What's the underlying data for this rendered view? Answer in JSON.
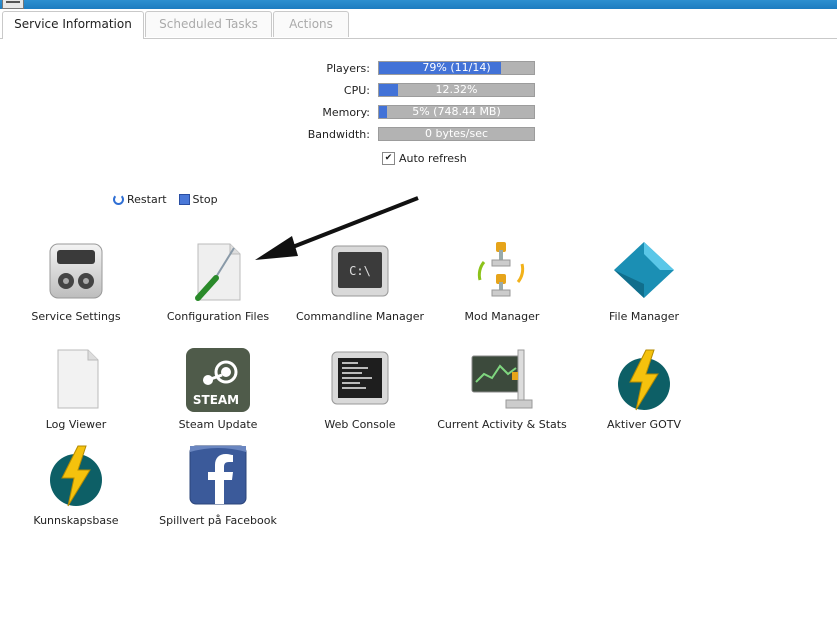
{
  "tabs": [
    {
      "label": "Service Information",
      "active": true
    },
    {
      "label": "Scheduled Tasks",
      "active": false
    },
    {
      "label": "Actions",
      "active": false
    }
  ],
  "stats": {
    "players": {
      "label": "Players:",
      "text": "79% (11/14)",
      "fraction": 0.79
    },
    "cpu": {
      "label": "CPU:",
      "text": "12.32%",
      "fraction": 0.1232
    },
    "memory": {
      "label": "Memory:",
      "text": "5% (748.44 MB)",
      "fraction": 0.05
    },
    "bandwidth": {
      "label": "Bandwidth:",
      "text": "0 bytes/sec",
      "fraction": 0
    }
  },
  "auto_refresh": {
    "label": "Auto refresh",
    "checked": true
  },
  "controls": {
    "restart": "Restart",
    "stop": "Stop"
  },
  "tiles": [
    {
      "label": "Service Settings",
      "icon": "service-settings-icon"
    },
    {
      "label": "Configuration Files",
      "icon": "configuration-files-icon"
    },
    {
      "label": "Commandline Manager",
      "icon": "commandline-icon"
    },
    {
      "label": "Mod Manager",
      "icon": "mod-manager-icon"
    },
    {
      "label": "File Manager",
      "icon": "file-manager-icon"
    },
    {
      "label": "Log Viewer",
      "icon": "log-viewer-icon"
    },
    {
      "label": "Steam Update",
      "icon": "steam-icon",
      "logo_text": "STEAM"
    },
    {
      "label": "Web Console",
      "icon": "web-console-icon"
    },
    {
      "label": "Current Activity & Stats",
      "icon": "activity-stats-icon"
    },
    {
      "label": "Aktiver GOTV",
      "icon": "gotv-icon"
    },
    {
      "label": "Kunnskapsbase",
      "icon": "knowledge-base-icon"
    },
    {
      "label": "Spillvert på Facebook",
      "icon": "facebook-icon"
    }
  ],
  "colors": {
    "bar_fill": "#4272d7",
    "bar_bg": "#b3b3b3",
    "titlebar": "#2d8fd0"
  }
}
